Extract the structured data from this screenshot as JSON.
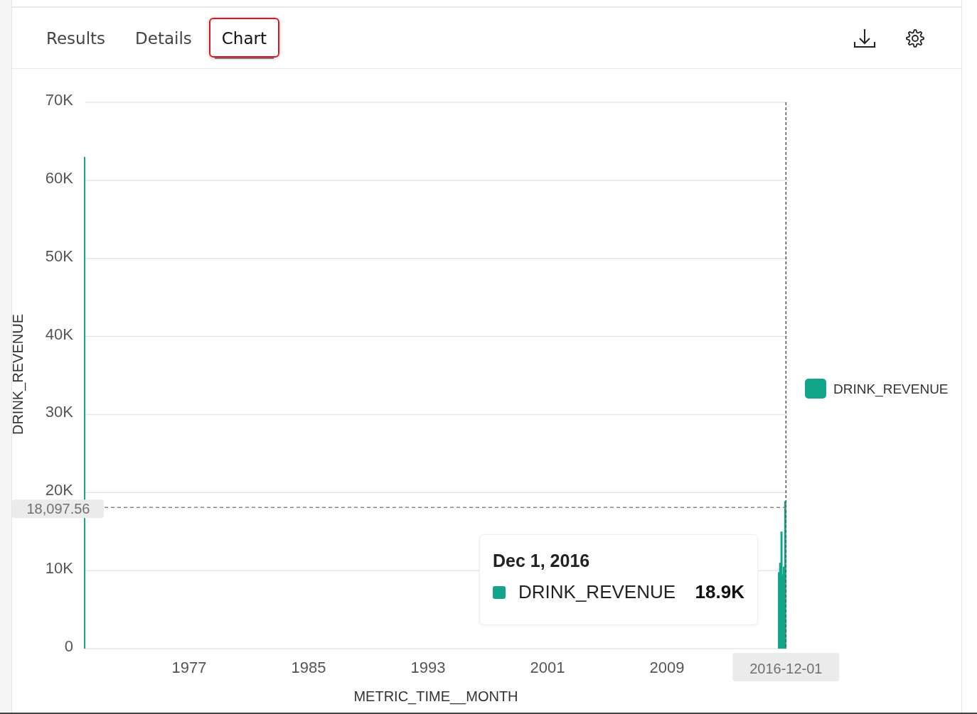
{
  "tabs": [
    {
      "label": "Results",
      "selected": false
    },
    {
      "label": "Details",
      "selected": false
    },
    {
      "label": "Chart",
      "selected": true
    }
  ],
  "chart": {
    "chart_data": {
      "type": "bar",
      "xlabel": "METRIC_TIME__MONTH",
      "ylabel": "DRINK_REVENUE",
      "x": [
        1970,
        2016.5,
        2016.58,
        2016.67,
        2016.75,
        2016.83,
        2016.92
      ],
      "series": [
        {
          "name": "DRINK_REVENUE",
          "color": "#12a58a",
          "values": [
            63000,
            9800,
            11000,
            15000,
            9500,
            10500,
            18900
          ]
        }
      ],
      "grid": true,
      "ref_lines": [
        {
          "axis": "x",
          "value": 2016.92
        },
        {
          "axis": "y",
          "value": 18097.56
        }
      ],
      "xlim": [
        1970,
        2017.1
      ],
      "ylim": [
        0,
        70000
      ],
      "xticks": [
        1977,
        1985,
        1993,
        2001,
        2009
      ],
      "yticks": [
        {
          "value": 0,
          "label": "0"
        },
        {
          "value": 10000,
          "label": "10K"
        },
        {
          "value": 20000,
          "label": "20K"
        },
        {
          "value": 30000,
          "label": "30K"
        },
        {
          "value": 40000,
          "label": "40K"
        },
        {
          "value": 50000,
          "label": "50K"
        },
        {
          "value": 60000,
          "label": "60K"
        },
        {
          "value": 70000,
          "label": "70K"
        }
      ]
    },
    "crosshair": {
      "y_label": "18,097.56",
      "x_label": "2016-12-01"
    },
    "tooltip": {
      "title": "Dec 1, 2016",
      "series": "DRINK_REVENUE",
      "value": "18.9K"
    }
  }
}
